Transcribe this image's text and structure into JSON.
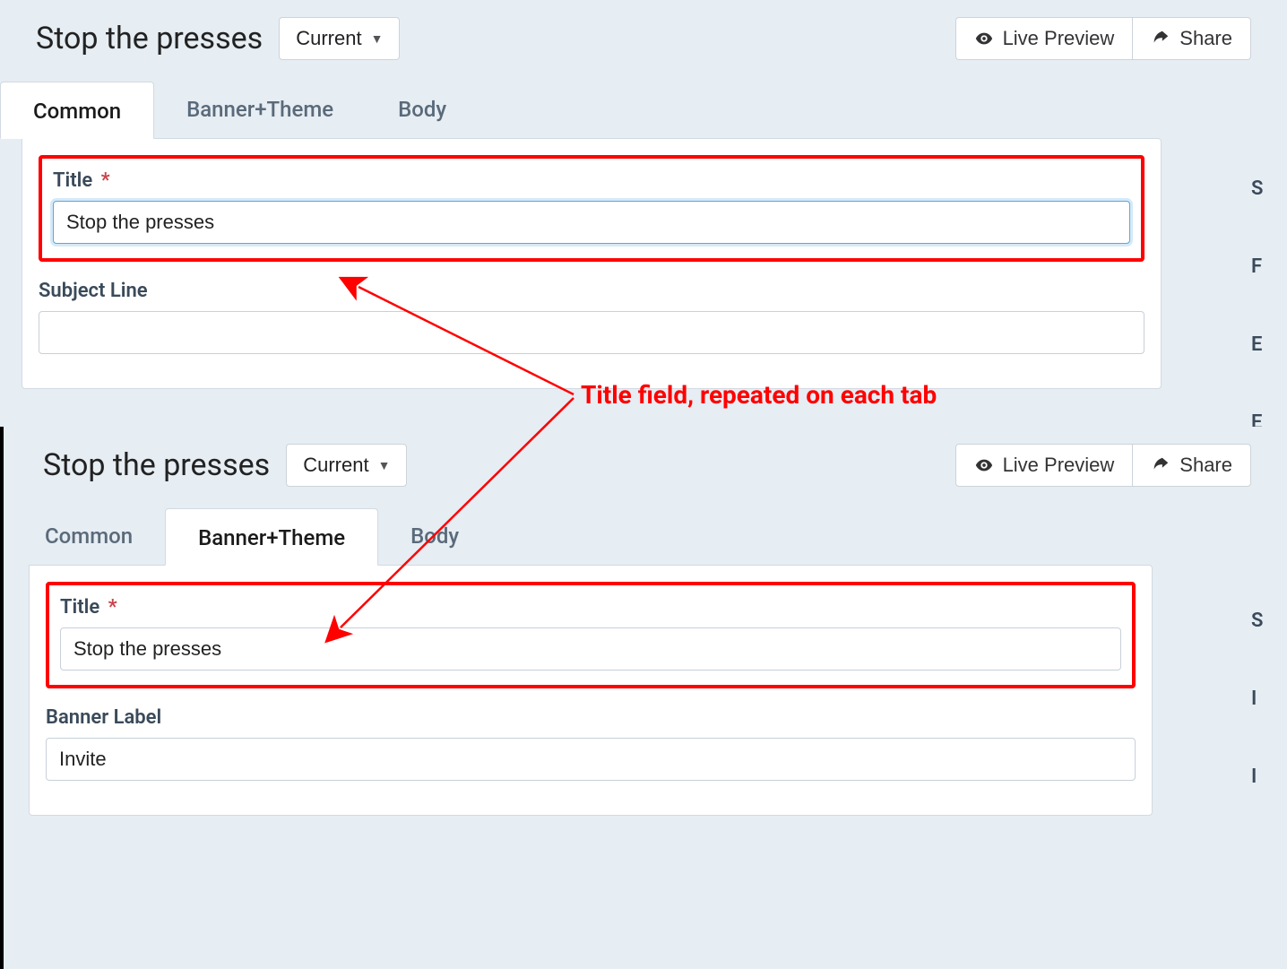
{
  "top": {
    "title": "Stop the presses",
    "version": "Current",
    "actions": {
      "preview": "Live Preview",
      "share": "Share"
    },
    "tabs": [
      "Common",
      "Banner+Theme",
      "Body"
    ],
    "active_tab": 0,
    "fields": {
      "title_label": "Title",
      "title_value": "Stop the presses",
      "subject_label": "Subject Line",
      "subject_value": ""
    },
    "side": [
      "S",
      "F",
      "E",
      "E"
    ]
  },
  "bottom": {
    "title": "Stop the presses",
    "version": "Current",
    "actions": {
      "preview": "Live Preview",
      "share": "Share"
    },
    "tabs": [
      "Common",
      "Banner+Theme",
      "Body"
    ],
    "active_tab": 1,
    "fields": {
      "title_label": "Title",
      "title_value": "Stop the presses",
      "banner_label": "Banner Label",
      "banner_value": "Invite"
    },
    "side": [
      "S",
      "I",
      "I"
    ]
  },
  "annotation": {
    "text": "Title field, repeated on each tab"
  }
}
